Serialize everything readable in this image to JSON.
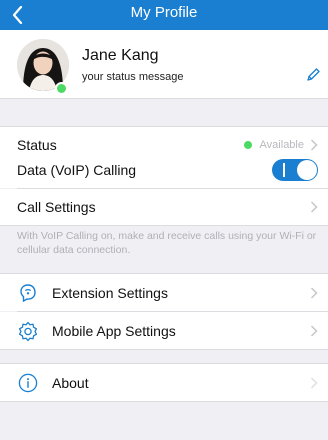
{
  "header": {
    "title": "My Profile",
    "back_icon": "chevron-left-icon"
  },
  "profile": {
    "name": "Jane Kang",
    "status_message": "your status message",
    "presence_color": "#4cd964",
    "edit_icon": "pencil-icon"
  },
  "status_row": {
    "label": "Status",
    "value": "Available",
    "dot_color": "#4cd964"
  },
  "calling": {
    "label": "Data (VoIP) Calling",
    "enabled": true,
    "call_settings_label": "Call Settings",
    "footnote": "With VoIP Calling on, make and receive calls using your Wi-Fi or cellular data connection."
  },
  "menu": {
    "extension_settings": {
      "label": "Extension Settings",
      "icon": "extension-icon"
    },
    "mobile_app_settings": {
      "label": "Mobile App Settings",
      "icon": "gear-icon"
    }
  },
  "about": {
    "label": "About",
    "icon": "info-icon"
  },
  "colors": {
    "accent": "#1a7fd0",
    "background": "#efeff4"
  }
}
